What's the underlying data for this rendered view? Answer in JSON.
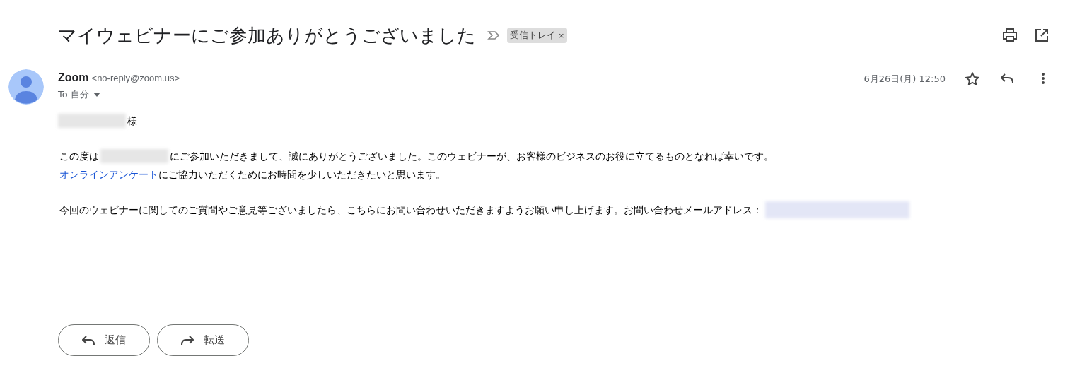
{
  "subject": "マイウェビナーにご参加ありがとうございました",
  "label": {
    "text": "受信トレイ",
    "close": "×"
  },
  "sender": {
    "name": "Zoom",
    "email": "<no-reply@zoom.us>",
    "to": "To 自分",
    "date": "6月26日(月) 12:50"
  },
  "body": [
    [
      {
        "kind": "redacted"
      },
      {
        "kind": "text",
        "text": "様"
      }
    ],
    [
      {
        "kind": "text",
        "text": "この度は"
      },
      {
        "kind": "redacted"
      },
      {
        "kind": "text",
        "text": "にご参加いただきまして、誠にありがとうございました。このウェビナーが、お客様のビジネスのお役に立てるものとなれば幸いです。"
      }
    ],
    [
      {
        "kind": "link",
        "text": "オンラインアンケート"
      },
      {
        "kind": "text",
        "text": "にご協力いただくためにお時間を少しいただきたいと思います。"
      }
    ],
    [
      {
        "kind": "text",
        "text": "今回のウェビナーに関してのご質問やご意見等ございましたら、こちらにお問い合わせいただきますようお願い申し上げます。お問い合わせメールアドレス："
      },
      {
        "kind": "redacted_link"
      }
    ]
  ],
  "buttons": [
    {
      "kind": "reply",
      "label": "返信"
    },
    {
      "kind": "forward",
      "label": "転送"
    }
  ]
}
